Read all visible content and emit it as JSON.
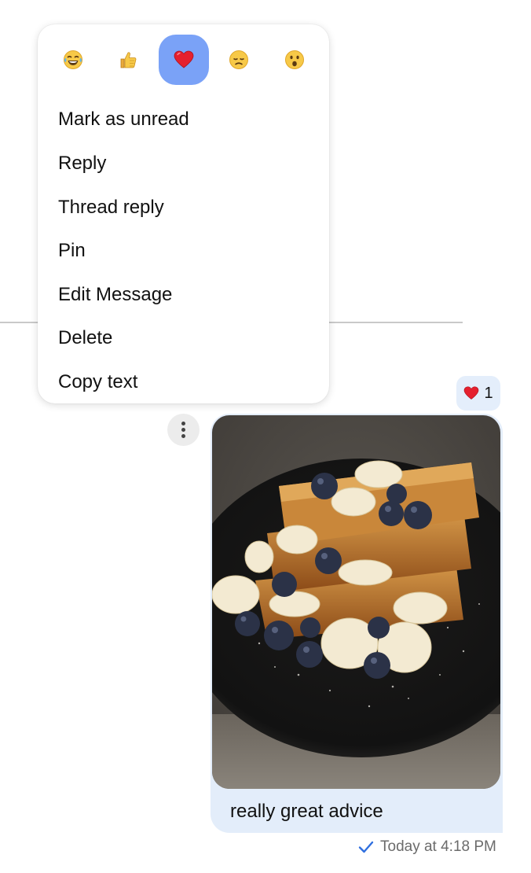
{
  "reactions": [
    {
      "name": "laughing-tears-icon",
      "selected": false
    },
    {
      "name": "thumbs-up-icon",
      "selected": false
    },
    {
      "name": "red-heart-icon",
      "selected": true
    },
    {
      "name": "disappointed-face-icon",
      "selected": false
    },
    {
      "name": "surprised-face-icon",
      "selected": false
    }
  ],
  "menu": {
    "mark_unread": "Mark as unread",
    "reply": "Reply",
    "thread_reply": "Thread reply",
    "pin": "Pin",
    "edit_message": "Edit Message",
    "delete": "Delete",
    "copy_text": "Copy text"
  },
  "message": {
    "reaction_icon": "red-heart-icon",
    "reaction_count": "1",
    "image_subject": "french-toast-with-bananas-and-blueberries",
    "caption": "really great advice",
    "status_icon": "checkmark-icon",
    "timestamp": "Today at 4:18 PM"
  },
  "colors": {
    "selected_reaction_bg": "#7aa2f7",
    "bubble_bg": "#e3edfa",
    "check": "#2f6fdf"
  }
}
